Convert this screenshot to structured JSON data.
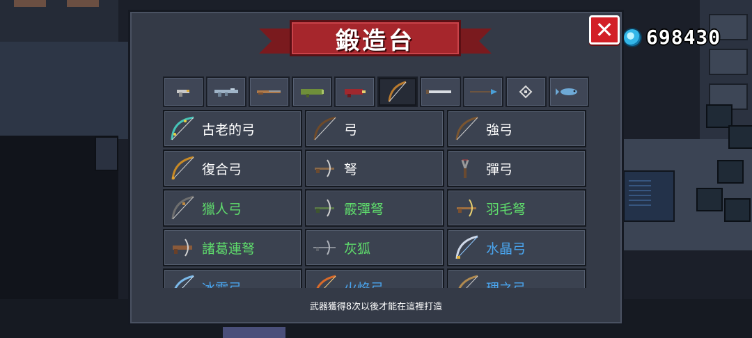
{
  "currency": {
    "icon": "blue-gem-icon",
    "amount": "698430"
  },
  "dialog": {
    "title": "鍛造台",
    "close_icon": "close-x-icon",
    "hint": "武器獲得8次以後才能在這裡打造"
  },
  "tabs": [
    {
      "icon": "pistol-icon",
      "active": false
    },
    {
      "icon": "assault-rifle-icon",
      "active": false
    },
    {
      "icon": "shotgun-icon",
      "active": false
    },
    {
      "icon": "rocket-launcher-icon",
      "active": false
    },
    {
      "icon": "laser-gun-icon",
      "active": false
    },
    {
      "icon": "bow-icon",
      "active": true
    },
    {
      "icon": "sword-icon",
      "active": false
    },
    {
      "icon": "spear-icon",
      "active": false
    },
    {
      "icon": "diamond-staff-icon",
      "active": false
    },
    {
      "icon": "fish-icon",
      "active": false
    }
  ],
  "weapons": [
    {
      "name": "古老的弓",
      "grade": "white",
      "icon": "ancient-bow-icon"
    },
    {
      "name": "弓",
      "grade": "white",
      "icon": "bow-icon"
    },
    {
      "name": "強弓",
      "grade": "white",
      "icon": "strong-bow-icon"
    },
    {
      "name": "復合弓",
      "grade": "white",
      "icon": "compound-bow-icon"
    },
    {
      "name": "弩",
      "grade": "white",
      "icon": "crossbow-icon"
    },
    {
      "name": "彈弓",
      "grade": "white",
      "icon": "slingshot-icon"
    },
    {
      "name": "獵人弓",
      "grade": "green",
      "icon": "hunter-bow-icon"
    },
    {
      "name": "霰彈弩",
      "grade": "green",
      "icon": "shotgun-crossbow-icon"
    },
    {
      "name": "羽毛弩",
      "grade": "green",
      "icon": "feather-crossbow-icon"
    },
    {
      "name": "諸葛連弩",
      "grade": "green",
      "icon": "repeating-crossbow-icon"
    },
    {
      "name": "灰狐",
      "grade": "green",
      "icon": "gray-fox-crossbow-icon"
    },
    {
      "name": "水晶弓",
      "grade": "blue",
      "icon": "crystal-bow-icon"
    },
    {
      "name": "冰霜弓",
      "grade": "blue",
      "icon": "frost-bow-icon"
    },
    {
      "name": "火焰弓",
      "grade": "blue",
      "icon": "flame-bow-icon"
    },
    {
      "name": "理之弓",
      "grade": "blue",
      "icon": "reason-bow-icon"
    }
  ],
  "colors": {
    "white": "#ffffff",
    "green": "#5fdc6c",
    "blue": "#4aa6f0",
    "banner": "#a6262c",
    "close": "#d21f26"
  }
}
